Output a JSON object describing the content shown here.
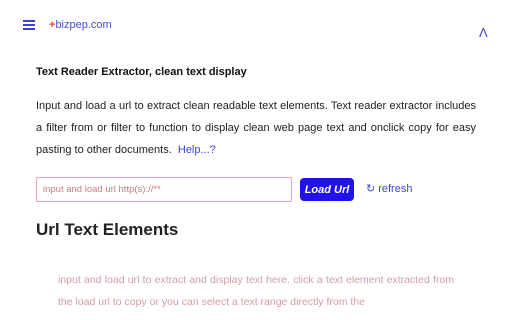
{
  "header": {
    "logo_plus": "+",
    "logo_text": "bizpep.com"
  },
  "main": {
    "heading": "Text Reader Extractor, clean text display",
    "intro_text": "Input and load a url to extract clean readable text elements. Text reader extractor includes a filter from or filter to function to display clean web page text and onclick copy for easy pasting to other documents.",
    "help_link": "Help...?",
    "url_input": {
      "placeholder": "input and load url http(s)://**",
      "value": ""
    },
    "load_button": "Load Url",
    "refresh_icon": "↻",
    "refresh_label": "refresh",
    "section_title": "Url Text Elements",
    "output_hint": "input and load url to extract and display text here. click a text element extracted from the load url to copy or you can select a text range directly from the"
  },
  "icons": {
    "menu": "hamburger-menu-icon",
    "collapse": "collapse-up-icon",
    "refresh": "refresh-icon"
  },
  "colors": {
    "accent": "#3d3fd6",
    "brand_plus": "#e8452c",
    "button_bg": "#1f12ec",
    "input_border": "#e9a5ad",
    "placeholder": "#cc7c83",
    "output_hint": "#d49da2"
  }
}
